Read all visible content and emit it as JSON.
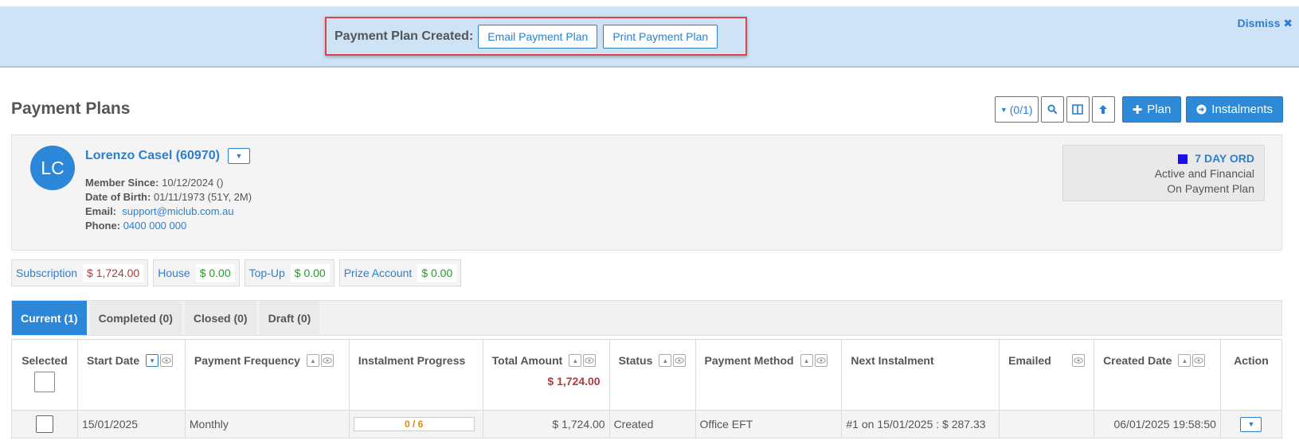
{
  "banner": {
    "title": "Payment Plan Created:",
    "email_button": "Email Payment Plan",
    "print_button": "Print Payment Plan",
    "dismiss": "Dismiss"
  },
  "page": {
    "title": "Payment Plans"
  },
  "toolbar": {
    "filter_count": "(0/1)",
    "plan_button": "Plan",
    "instalments_button": "Instalments"
  },
  "member": {
    "initials": "LC",
    "name": "Lorenzo Casel (60970)",
    "member_since_label": "Member Since:",
    "member_since": "10/12/2024 ()",
    "dob_label": "Date of Birth:",
    "dob": "01/11/1973 (51Y, 2M)",
    "email_label": "Email:",
    "email": "support@miclub.com.au",
    "phone_label": "Phone:",
    "phone": "0400 000 000",
    "category": "7 DAY ORD",
    "status_line1": "Active and Financial",
    "status_line2": "On Payment Plan",
    "category_color": "#1a0ef0"
  },
  "accounts": [
    {
      "label": "Subscription",
      "value": "$ 1,724.00",
      "color": "#b03a3a"
    },
    {
      "label": "House",
      "value": "$ 0.00",
      "color": "#1f9e1f"
    },
    {
      "label": "Top-Up",
      "value": "$ 0.00",
      "color": "#1f9e1f"
    },
    {
      "label": "Prize Account",
      "value": "$ 0.00",
      "color": "#1f9e1f"
    }
  ],
  "tabs": [
    {
      "label": "Current (1)"
    },
    {
      "label": "Completed (0)"
    },
    {
      "label": "Closed (0)"
    },
    {
      "label": "Draft (0)"
    }
  ],
  "table": {
    "headers": {
      "selected": "Selected",
      "start_date": "Start Date",
      "payment_frequency": "Payment Frequency",
      "instalment_progress": "Instalment Progress",
      "total_amount": "Total Amount",
      "status": "Status",
      "payment_method": "Payment Method",
      "next_instalment": "Next Instalment",
      "emailed": "Emailed",
      "created_date": "Created Date",
      "action": "Action"
    },
    "total_sum": "$ 1,724.00",
    "rows": [
      {
        "start_date": "15/01/2025",
        "payment_frequency": "Monthly",
        "instalment_progress": "0 / 6",
        "total_amount": "$ 1,724.00",
        "status": "Created",
        "payment_method": "Office EFT",
        "next_instalment": "#1 on 15/01/2025 : $ 287.33",
        "emailed": "",
        "created_date": "06/01/2025 19:58:50"
      }
    ]
  }
}
